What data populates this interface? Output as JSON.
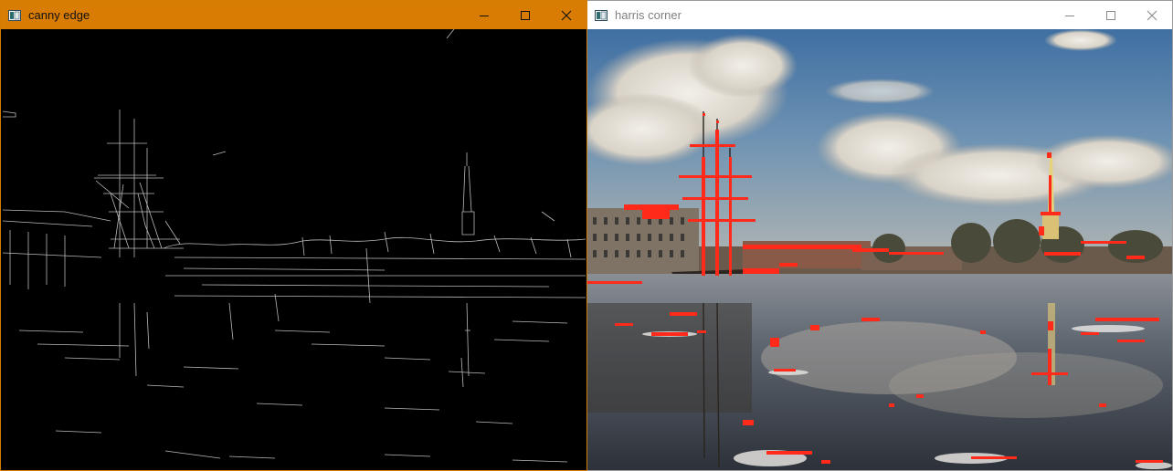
{
  "windows": {
    "left": {
      "title": "canny edge",
      "icon": "image-window-icon",
      "controls": [
        "minimize",
        "maximize",
        "close"
      ],
      "content": "edge-detection-output",
      "accent": "#d87c04"
    },
    "right": {
      "title": "harris corner",
      "icon": "image-window-icon",
      "controls": [
        "minimize",
        "maximize",
        "close"
      ],
      "content": "corner-detection-output",
      "marker_color": "#ff2a1a"
    }
  }
}
